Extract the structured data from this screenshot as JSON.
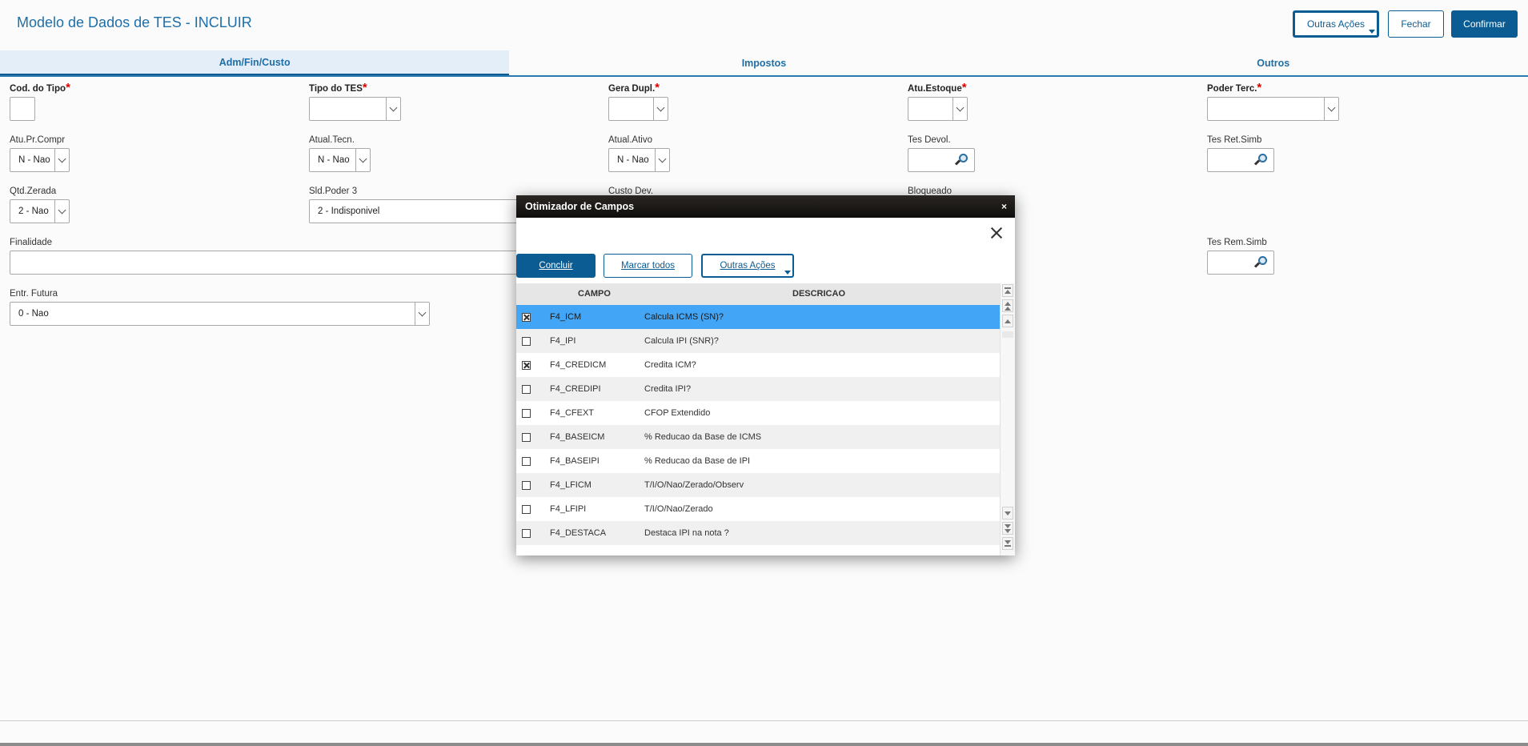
{
  "page": {
    "title": "Modelo de Dados de TES - INCLUIR",
    "buttons": {
      "outras_acoes": "Outras Ações",
      "fechar": "Fechar",
      "confirmar": "Confirmar"
    }
  },
  "tabs": [
    {
      "label": "Adm/Fin/Custo",
      "active": true
    },
    {
      "label": "Impostos",
      "active": false
    },
    {
      "label": "Outros",
      "active": false
    }
  ],
  "fields": {
    "cod_tipo": {
      "label": "Cod. do Tipo",
      "required": true,
      "value": ""
    },
    "tipo_tes": {
      "label": "Tipo do TES",
      "required": true,
      "value": ""
    },
    "gera_dupl": {
      "label": "Gera Dupl.",
      "required": true,
      "value": ""
    },
    "atu_estoque": {
      "label": "Atu.Estoque",
      "required": true,
      "value": ""
    },
    "poder_terc": {
      "label": "Poder Terc.",
      "required": true,
      "value": ""
    },
    "atu_pr_compr": {
      "label": "Atu.Pr.Compr",
      "value": "N - Nao"
    },
    "atual_tecn": {
      "label": "Atual.Tecn.",
      "value": "N - Nao"
    },
    "atual_ativo": {
      "label": "Atual.Ativo",
      "value": "N - Nao"
    },
    "tes_devol": {
      "label": "Tes Devol.",
      "value": ""
    },
    "tes_ret_simb": {
      "label": "Tes Ret.Simb",
      "value": ""
    },
    "qtd_zerada": {
      "label": "Qtd.Zerada",
      "value": "2 - Nao"
    },
    "sld_poder_3": {
      "label": "Sld.Poder 3",
      "value": "2 - Indisponivel"
    },
    "custo_dev": {
      "label": "Custo Dev.",
      "value": ""
    },
    "bloqueado": {
      "label": "Bloqueado",
      "value": ""
    },
    "finalidade": {
      "label": "Finalidade",
      "value": ""
    },
    "tes_rem_simb": {
      "label": "Tes Rem.Simb",
      "value": ""
    },
    "entr_futura": {
      "label": "Entr. Futura",
      "value": "0 - Nao"
    }
  },
  "modal": {
    "title": "Otimizador de Campos",
    "close_small": "×",
    "buttons": {
      "concluir": "Concluir",
      "marcar_todos": "Marcar todos",
      "outras_acoes": "Outras Ações"
    },
    "columns": {
      "campo": "CAMPO",
      "descricao": "DESCRICAO"
    },
    "rows": [
      {
        "campo": "F4_ICM",
        "descricao": "Calcula ICMS (SN)?",
        "checked": true,
        "selected": true
      },
      {
        "campo": "F4_IPI",
        "descricao": "Calcula IPI (SNR)?",
        "checked": false
      },
      {
        "campo": "F4_CREDICM",
        "descricao": "Credita ICM?",
        "checked": true
      },
      {
        "campo": "F4_CREDIPI",
        "descricao": "Credita IPI?",
        "checked": false
      },
      {
        "campo": "F4_CFEXT",
        "descricao": "CFOP Extendido",
        "checked": false
      },
      {
        "campo": "F4_BASEICM",
        "descricao": "% Reducao da Base de ICMS",
        "checked": false
      },
      {
        "campo": "F4_BASEIPI",
        "descricao": "% Reducao da Base de IPI",
        "checked": false
      },
      {
        "campo": "F4_LFICM",
        "descricao": "T/I/O/Nao/Zerado/Observ",
        "checked": false
      },
      {
        "campo": "F4_LFIPI",
        "descricao": "T/I/O/Nao/Zerado",
        "checked": false
      },
      {
        "campo": "F4_DESTACA",
        "descricao": "Destaca IPI na nota ?",
        "checked": false
      }
    ]
  },
  "colors": {
    "primary": "#0b5c92",
    "title": "#1e6fa8",
    "row_selected": "#42a5f5",
    "required": "#dd0000"
  }
}
